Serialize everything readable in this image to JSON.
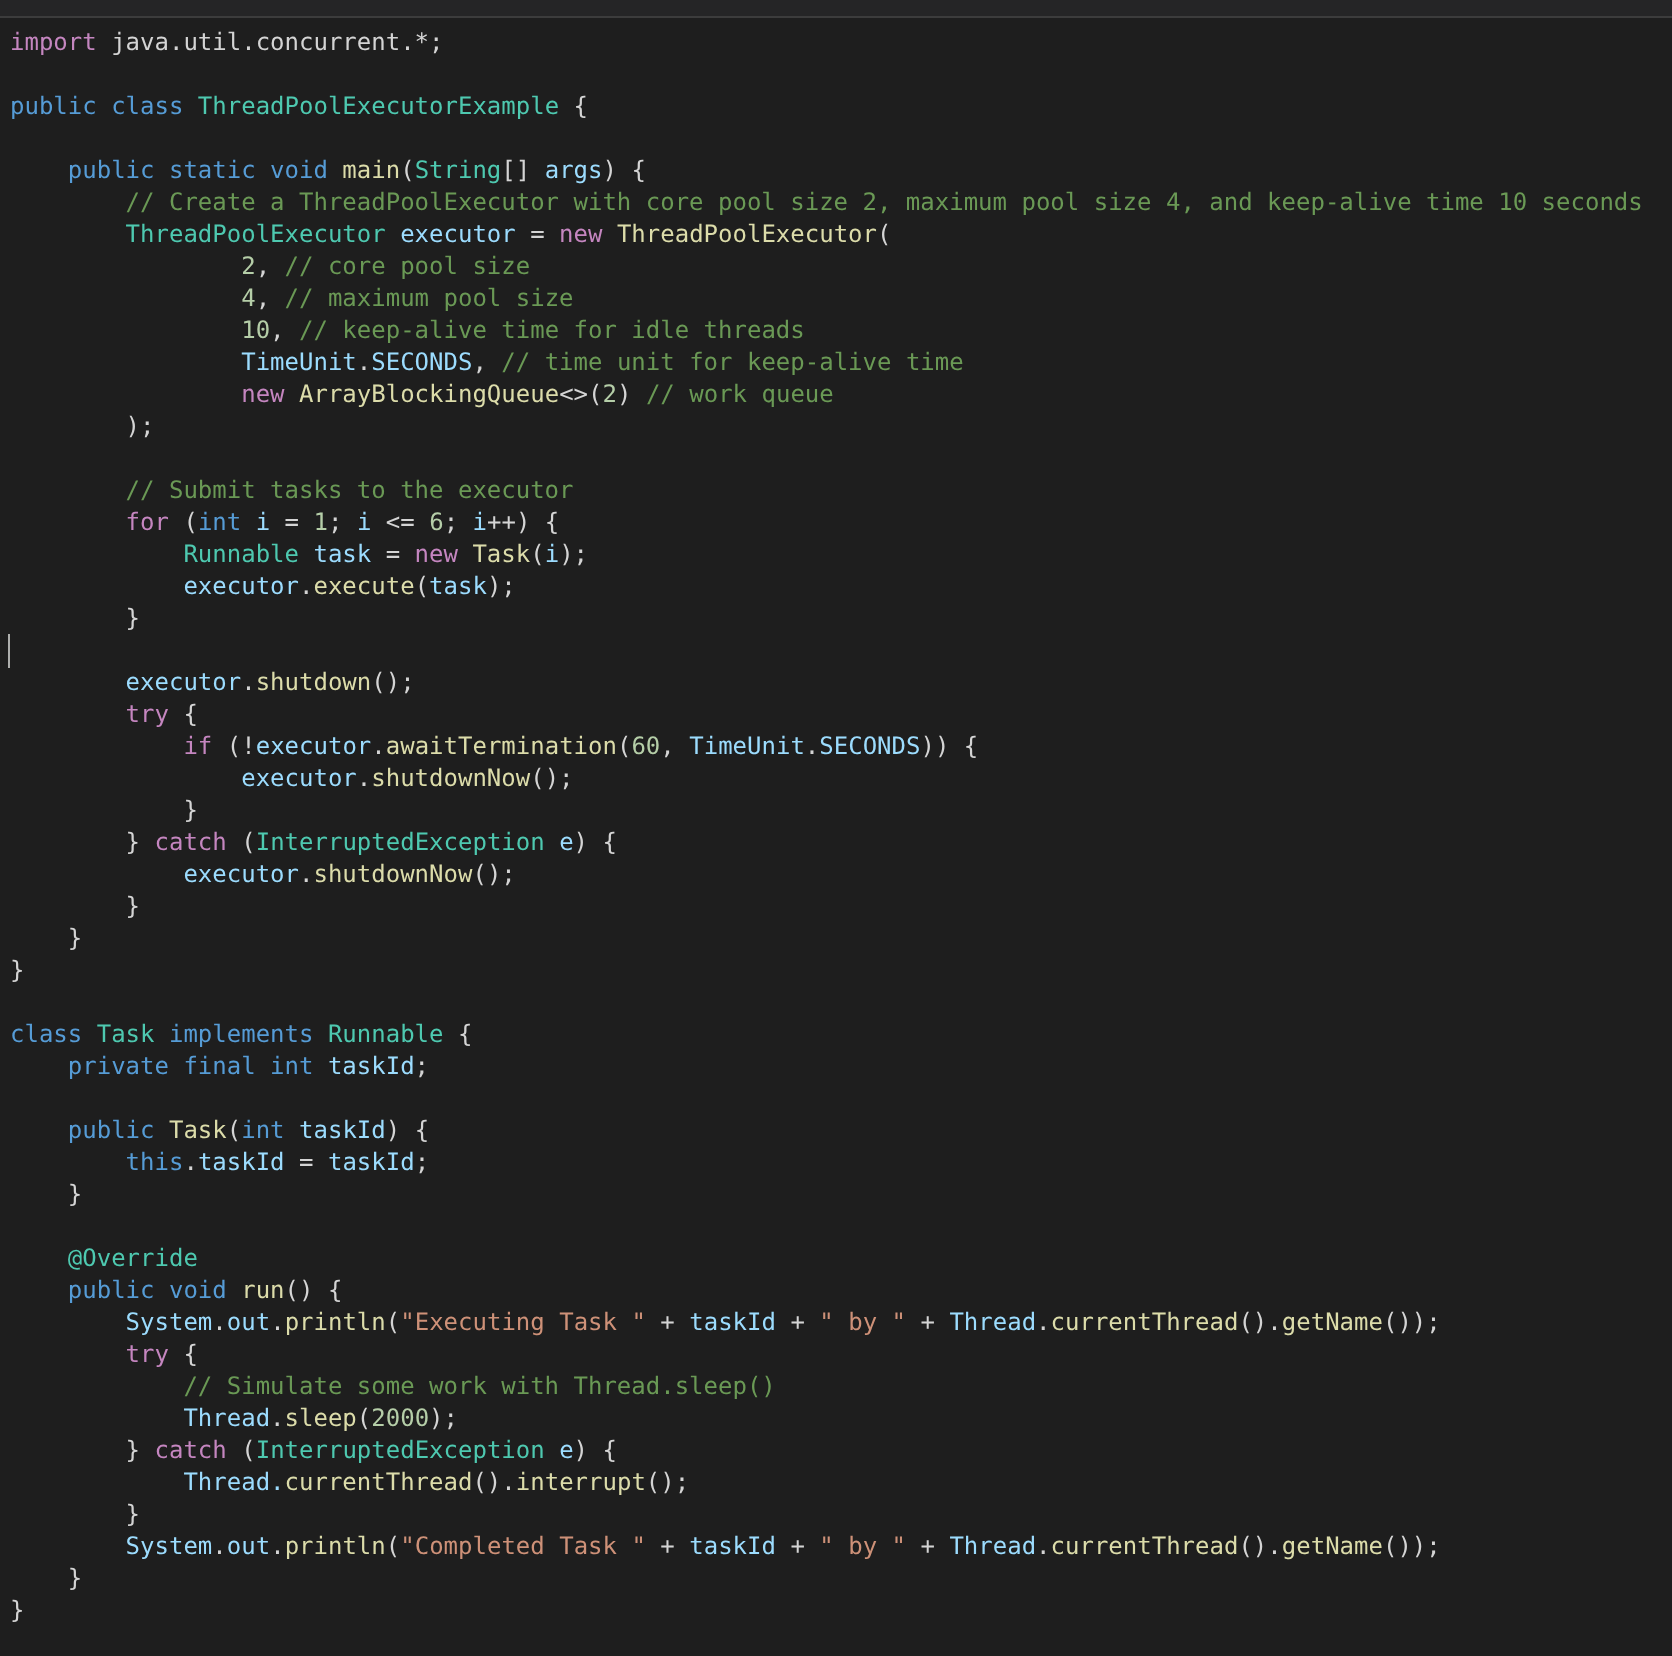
{
  "editor": {
    "lines": [
      {
        "caret": false,
        "tokens": [
          {
            "kind": "control",
            "text": "import"
          },
          {
            "kind": "plain",
            "text": " java.util.concurrent.*;"
          }
        ]
      },
      {
        "caret": false
      },
      {
        "caret": false,
        "tokens": [
          {
            "kind": "keyword",
            "text": "public class"
          },
          {
            "kind": "type",
            "text": " ThreadPoolExecutorExample"
          },
          {
            "kind": "plain",
            "text": " {"
          }
        ]
      },
      {
        "caret": false
      },
      {
        "caret": false,
        "tokens": [
          {
            "kind": "keyword",
            "text": "    public static void"
          },
          {
            "kind": "function",
            "text": " main"
          },
          {
            "kind": "plain",
            "text": "("
          },
          {
            "kind": "type",
            "text": "String"
          },
          {
            "kind": "plain",
            "text": "[]"
          },
          {
            "kind": "variable",
            "text": " args"
          },
          {
            "kind": "plain",
            "text": ") {"
          }
        ]
      },
      {
        "caret": false,
        "tokens": [
          {
            "kind": "comment",
            "text": "        // Create a ThreadPoolExecutor with core pool size 2, maximum pool size 4, and keep-alive time 10 seconds"
          }
        ]
      },
      {
        "caret": false,
        "tokens": [
          {
            "kind": "type",
            "text": "        ThreadPoolExecutor"
          },
          {
            "kind": "variable",
            "text": " executor"
          },
          {
            "kind": "plain",
            "text": " ="
          },
          {
            "kind": "control",
            "text": " new"
          },
          {
            "kind": "function",
            "text": " ThreadPoolExecutor"
          },
          {
            "kind": "plain",
            "text": "("
          }
        ]
      },
      {
        "caret": false,
        "tokens": [
          {
            "kind": "number",
            "text": "                2"
          },
          {
            "kind": "plain",
            "text": ","
          },
          {
            "kind": "comment",
            "text": " // core pool size"
          }
        ]
      },
      {
        "caret": false,
        "tokens": [
          {
            "kind": "number",
            "text": "                4"
          },
          {
            "kind": "plain",
            "text": ","
          },
          {
            "kind": "comment",
            "text": " // maximum pool size"
          }
        ]
      },
      {
        "caret": false,
        "tokens": [
          {
            "kind": "number",
            "text": "                10"
          },
          {
            "kind": "plain",
            "text": ","
          },
          {
            "kind": "comment",
            "text": " // keep-alive time for idle threads"
          }
        ]
      },
      {
        "caret": false,
        "tokens": [
          {
            "kind": "variable",
            "text": "                TimeUnit"
          },
          {
            "kind": "plain",
            "text": "."
          },
          {
            "kind": "variable",
            "text": "SECONDS"
          },
          {
            "kind": "plain",
            "text": ","
          },
          {
            "kind": "comment",
            "text": " // time unit for keep-alive time"
          }
        ]
      },
      {
        "caret": false,
        "tokens": [
          {
            "kind": "control",
            "text": "                new"
          },
          {
            "kind": "function",
            "text": " ArrayBlockingQueue"
          },
          {
            "kind": "plain",
            "text": "<>("
          },
          {
            "kind": "number",
            "text": "2"
          },
          {
            "kind": "plain",
            "text": ")"
          },
          {
            "kind": "comment",
            "text": " // work queue"
          }
        ]
      },
      {
        "caret": false,
        "tokens": [
          {
            "kind": "plain",
            "text": "        );"
          }
        ]
      },
      {
        "caret": false
      },
      {
        "caret": false,
        "tokens": [
          {
            "kind": "comment",
            "text": "        // Submit tasks to the executor"
          }
        ]
      },
      {
        "caret": false,
        "tokens": [
          {
            "kind": "control",
            "text": "        for"
          },
          {
            "kind": "plain",
            "text": " ("
          },
          {
            "kind": "keyword",
            "text": "int"
          },
          {
            "kind": "variable",
            "text": " i"
          },
          {
            "kind": "plain",
            "text": " ="
          },
          {
            "kind": "number",
            "text": " 1"
          },
          {
            "kind": "plain",
            "text": ";"
          },
          {
            "kind": "variable",
            "text": " i"
          },
          {
            "kind": "plain",
            "text": " <="
          },
          {
            "kind": "number",
            "text": " 6"
          },
          {
            "kind": "plain",
            "text": ";"
          },
          {
            "kind": "variable",
            "text": " i"
          },
          {
            "kind": "plain",
            "text": "++) {"
          }
        ]
      },
      {
        "caret": false,
        "tokens": [
          {
            "kind": "type",
            "text": "            Runnable"
          },
          {
            "kind": "variable",
            "text": " task"
          },
          {
            "kind": "plain",
            "text": " ="
          },
          {
            "kind": "control",
            "text": " new"
          },
          {
            "kind": "function",
            "text": " Task"
          },
          {
            "kind": "plain",
            "text": "("
          },
          {
            "kind": "variable",
            "text": "i"
          },
          {
            "kind": "plain",
            "text": ");"
          }
        ]
      },
      {
        "caret": false,
        "tokens": [
          {
            "kind": "variable",
            "text": "            executor"
          },
          {
            "kind": "plain",
            "text": "."
          },
          {
            "kind": "function",
            "text": "execute"
          },
          {
            "kind": "plain",
            "text": "("
          },
          {
            "kind": "variable",
            "text": "task"
          },
          {
            "kind": "plain",
            "text": ");"
          }
        ]
      },
      {
        "caret": false,
        "tokens": [
          {
            "kind": "plain",
            "text": "        }"
          }
        ]
      },
      {
        "caret": true
      },
      {
        "caret": false,
        "tokens": [
          {
            "kind": "variable",
            "text": "        executor"
          },
          {
            "kind": "plain",
            "text": "."
          },
          {
            "kind": "function",
            "text": "shutdown"
          },
          {
            "kind": "plain",
            "text": "();"
          }
        ]
      },
      {
        "caret": false,
        "tokens": [
          {
            "kind": "control",
            "text": "        try"
          },
          {
            "kind": "plain",
            "text": " {"
          }
        ]
      },
      {
        "caret": false,
        "tokens": [
          {
            "kind": "control",
            "text": "            if"
          },
          {
            "kind": "plain",
            "text": " (!"
          },
          {
            "kind": "variable",
            "text": "executor"
          },
          {
            "kind": "plain",
            "text": "."
          },
          {
            "kind": "function",
            "text": "awaitTermination"
          },
          {
            "kind": "plain",
            "text": "("
          },
          {
            "kind": "number",
            "text": "60"
          },
          {
            "kind": "plain",
            "text": ","
          },
          {
            "kind": "variable",
            "text": " TimeUnit"
          },
          {
            "kind": "plain",
            "text": "."
          },
          {
            "kind": "variable",
            "text": "SECONDS"
          },
          {
            "kind": "plain",
            "text": ")) {"
          }
        ]
      },
      {
        "caret": false,
        "tokens": [
          {
            "kind": "variable",
            "text": "                executor"
          },
          {
            "kind": "plain",
            "text": "."
          },
          {
            "kind": "function",
            "text": "shutdownNow"
          },
          {
            "kind": "plain",
            "text": "();"
          }
        ]
      },
      {
        "caret": false,
        "tokens": [
          {
            "kind": "plain",
            "text": "            }"
          }
        ]
      },
      {
        "caret": false,
        "tokens": [
          {
            "kind": "plain",
            "text": "        }"
          },
          {
            "kind": "control",
            "text": " catch"
          },
          {
            "kind": "plain",
            "text": " ("
          },
          {
            "kind": "type",
            "text": "InterruptedException"
          },
          {
            "kind": "variable",
            "text": " e"
          },
          {
            "kind": "plain",
            "text": ") {"
          }
        ]
      },
      {
        "caret": false,
        "tokens": [
          {
            "kind": "variable",
            "text": "            executor"
          },
          {
            "kind": "plain",
            "text": "."
          },
          {
            "kind": "function",
            "text": "shutdownNow"
          },
          {
            "kind": "plain",
            "text": "();"
          }
        ]
      },
      {
        "caret": false,
        "tokens": [
          {
            "kind": "plain",
            "text": "        }"
          }
        ]
      },
      {
        "caret": false,
        "tokens": [
          {
            "kind": "plain",
            "text": "    }"
          }
        ]
      },
      {
        "caret": false,
        "tokens": [
          {
            "kind": "plain",
            "text": "}"
          }
        ]
      },
      {
        "caret": false
      },
      {
        "caret": false,
        "tokens": [
          {
            "kind": "keyword",
            "text": "class"
          },
          {
            "kind": "type",
            "text": " Task"
          },
          {
            "kind": "keyword",
            "text": " implements"
          },
          {
            "kind": "type",
            "text": " Runnable"
          },
          {
            "kind": "plain",
            "text": " {"
          }
        ]
      },
      {
        "caret": false,
        "tokens": [
          {
            "kind": "keyword",
            "text": "    private final int"
          },
          {
            "kind": "variable",
            "text": " taskId"
          },
          {
            "kind": "plain",
            "text": ";"
          }
        ]
      },
      {
        "caret": false
      },
      {
        "caret": false,
        "tokens": [
          {
            "kind": "keyword",
            "text": "    public"
          },
          {
            "kind": "function",
            "text": " Task"
          },
          {
            "kind": "plain",
            "text": "("
          },
          {
            "kind": "keyword",
            "text": "int"
          },
          {
            "kind": "variable",
            "text": " taskId"
          },
          {
            "kind": "plain",
            "text": ") {"
          }
        ]
      },
      {
        "caret": false,
        "tokens": [
          {
            "kind": "keyword",
            "text": "        this"
          },
          {
            "kind": "plain",
            "text": "."
          },
          {
            "kind": "variable",
            "text": "taskId"
          },
          {
            "kind": "plain",
            "text": " ="
          },
          {
            "kind": "variable",
            "text": " taskId"
          },
          {
            "kind": "plain",
            "text": ";"
          }
        ]
      },
      {
        "caret": false,
        "tokens": [
          {
            "kind": "plain",
            "text": "    }"
          }
        ]
      },
      {
        "caret": false
      },
      {
        "caret": false,
        "tokens": [
          {
            "kind": "type",
            "text": "    @Override"
          }
        ]
      },
      {
        "caret": false,
        "tokens": [
          {
            "kind": "keyword",
            "text": "    public void"
          },
          {
            "kind": "function",
            "text": " run"
          },
          {
            "kind": "plain",
            "text": "() {"
          }
        ]
      },
      {
        "caret": false,
        "tokens": [
          {
            "kind": "variable",
            "text": "        System"
          },
          {
            "kind": "plain",
            "text": "."
          },
          {
            "kind": "variable",
            "text": "out"
          },
          {
            "kind": "plain",
            "text": "."
          },
          {
            "kind": "function",
            "text": "println"
          },
          {
            "kind": "plain",
            "text": "("
          },
          {
            "kind": "string",
            "text": "\"Executing Task \""
          },
          {
            "kind": "plain",
            "text": " +"
          },
          {
            "kind": "variable",
            "text": " taskId"
          },
          {
            "kind": "plain",
            "text": " +"
          },
          {
            "kind": "string",
            "text": " \" by \""
          },
          {
            "kind": "plain",
            "text": " +"
          },
          {
            "kind": "variable",
            "text": " Thread"
          },
          {
            "kind": "plain",
            "text": "."
          },
          {
            "kind": "function",
            "text": "currentThread"
          },
          {
            "kind": "plain",
            "text": "()."
          },
          {
            "kind": "function",
            "text": "getName"
          },
          {
            "kind": "plain",
            "text": "());"
          }
        ]
      },
      {
        "caret": false,
        "tokens": [
          {
            "kind": "control",
            "text": "        try"
          },
          {
            "kind": "plain",
            "text": " {"
          }
        ]
      },
      {
        "caret": false,
        "tokens": [
          {
            "kind": "comment",
            "text": "            // Simulate some work with Thread.sleep()"
          }
        ]
      },
      {
        "caret": false,
        "tokens": [
          {
            "kind": "variable",
            "text": "            Thread"
          },
          {
            "kind": "plain",
            "text": "."
          },
          {
            "kind": "function",
            "text": "sleep"
          },
          {
            "kind": "plain",
            "text": "("
          },
          {
            "kind": "number",
            "text": "2000"
          },
          {
            "kind": "plain",
            "text": ");"
          }
        ]
      },
      {
        "caret": false,
        "tokens": [
          {
            "kind": "plain",
            "text": "        }"
          },
          {
            "kind": "control",
            "text": " catch"
          },
          {
            "kind": "plain",
            "text": " ("
          },
          {
            "kind": "type",
            "text": "InterruptedException"
          },
          {
            "kind": "variable",
            "text": " e"
          },
          {
            "kind": "plain",
            "text": ") {"
          }
        ]
      },
      {
        "caret": false,
        "tokens": [
          {
            "kind": "variable",
            "text": "            Thread."
          },
          {
            "kind": "function",
            "text": "currentThread"
          },
          {
            "kind": "plain",
            "text": "()."
          },
          {
            "kind": "function",
            "text": "interrupt"
          },
          {
            "kind": "plain",
            "text": "();"
          }
        ]
      },
      {
        "caret": false,
        "tokens": [
          {
            "kind": "plain",
            "text": "        }"
          }
        ]
      },
      {
        "caret": false,
        "tokens": [
          {
            "kind": "variable",
            "text": "        System"
          },
          {
            "kind": "plain",
            "text": "."
          },
          {
            "kind": "variable",
            "text": "out"
          },
          {
            "kind": "plain",
            "text": "."
          },
          {
            "kind": "function",
            "text": "println"
          },
          {
            "kind": "plain",
            "text": "("
          },
          {
            "kind": "string",
            "text": "\"Completed Task \""
          },
          {
            "kind": "plain",
            "text": " +"
          },
          {
            "kind": "variable",
            "text": " taskId"
          },
          {
            "kind": "plain",
            "text": " +"
          },
          {
            "kind": "string",
            "text": " \" by \""
          },
          {
            "kind": "plain",
            "text": " +"
          },
          {
            "kind": "variable",
            "text": " Thread"
          },
          {
            "kind": "plain",
            "text": "."
          },
          {
            "kind": "function",
            "text": "currentThread"
          },
          {
            "kind": "plain",
            "text": "()."
          },
          {
            "kind": "function",
            "text": "getName"
          },
          {
            "kind": "plain",
            "text": "());"
          }
        ]
      },
      {
        "caret": false,
        "tokens": [
          {
            "kind": "plain",
            "text": "    }"
          }
        ]
      },
      {
        "caret": false,
        "tokens": [
          {
            "kind": "plain",
            "text": "}"
          }
        ]
      }
    ]
  }
}
